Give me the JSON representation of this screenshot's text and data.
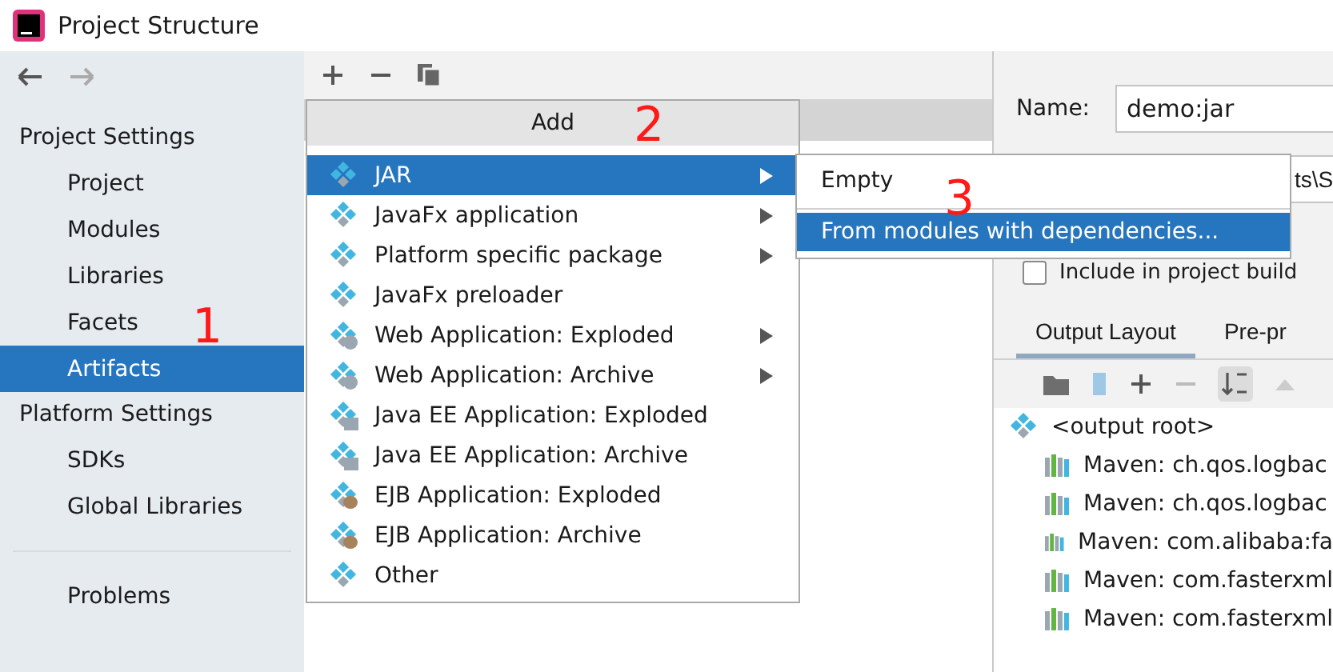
{
  "window": {
    "title": "Project Structure"
  },
  "sidebar": {
    "sections": [
      {
        "title": "Project Settings",
        "items": [
          {
            "label": "Project",
            "selected": false
          },
          {
            "label": "Modules",
            "selected": false
          },
          {
            "label": "Libraries",
            "selected": false
          },
          {
            "label": "Facets",
            "selected": false
          },
          {
            "label": "Artifacts",
            "selected": true
          }
        ]
      },
      {
        "title": "Platform Settings",
        "items": [
          {
            "label": "SDKs",
            "selected": false
          },
          {
            "label": "Global Libraries",
            "selected": false
          }
        ]
      },
      {
        "items": [
          {
            "label": "Problems",
            "selected": false
          }
        ]
      }
    ]
  },
  "add_menu": {
    "title": "Add",
    "items": [
      {
        "label": "JAR",
        "kind": "jar",
        "submenu": true,
        "selected": true
      },
      {
        "label": "JavaFx application",
        "kind": "jar",
        "submenu": true,
        "selected": false
      },
      {
        "label": "Platform specific package",
        "kind": "jar",
        "submenu": true,
        "selected": false
      },
      {
        "label": "JavaFx preloader",
        "kind": "jar",
        "submenu": false,
        "selected": false
      },
      {
        "label": "Web Application: Exploded",
        "kind": "web",
        "submenu": true,
        "selected": false
      },
      {
        "label": "Web Application: Archive",
        "kind": "web",
        "submenu": true,
        "selected": false
      },
      {
        "label": "Java EE Application: Exploded",
        "kind": "ee",
        "submenu": false,
        "selected": false
      },
      {
        "label": "Java EE Application: Archive",
        "kind": "ee",
        "submenu": false,
        "selected": false
      },
      {
        "label": "EJB Application: Exploded",
        "kind": "ejb",
        "submenu": false,
        "selected": false
      },
      {
        "label": "EJB Application: Archive",
        "kind": "ejb",
        "submenu": false,
        "selected": false
      },
      {
        "label": "Other",
        "kind": "jar",
        "submenu": false,
        "selected": false
      }
    ]
  },
  "jar_submenu": {
    "items": [
      {
        "label": "Empty",
        "selected": false
      },
      {
        "label": "From modules with dependencies...",
        "selected": true
      }
    ]
  },
  "annotations": [
    "1",
    "2",
    "3"
  ],
  "details": {
    "name_label": "Name:",
    "name_value": "demo:jar",
    "output_directory_value": "ts\\S",
    "include_in_build": {
      "label": "Include in project build",
      "checked": false
    },
    "tabs": [
      {
        "label": "Output Layout",
        "selected": true
      },
      {
        "label": "Pre-pr",
        "selected": false
      }
    ],
    "tree": {
      "label": "<output root>",
      "children": [
        {
          "label": "Maven: ch.qos.logbac"
        },
        {
          "label": "Maven: ch.qos.logbac"
        },
        {
          "label": "Maven: com.alibaba:fa"
        },
        {
          "label": "Maven: com.fasterxml"
        },
        {
          "label": "Maven: com.fasterxml"
        }
      ]
    }
  }
}
